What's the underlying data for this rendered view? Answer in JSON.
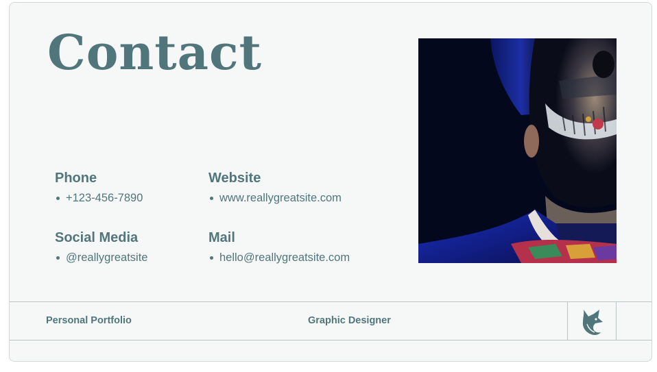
{
  "title": "Contact",
  "contacts": {
    "phone": {
      "heading": "Phone",
      "value": "+123-456-7890"
    },
    "website": {
      "heading": "Website",
      "value": "www.reallygreatsite.com"
    },
    "social": {
      "heading": "Social Media",
      "value": "@reallygreatsite"
    },
    "mail": {
      "heading": "Mail",
      "value": "hello@reallygreatsite.com"
    }
  },
  "footer": {
    "left": "Personal Portfolio",
    "center": "Graphic Designer",
    "logo_icon": "fox-icon"
  },
  "photo_icon": "skull-makeup-portrait",
  "colors": {
    "accent": "#50767b",
    "background": "#f6f8f8",
    "border": "#b8c4c6"
  }
}
